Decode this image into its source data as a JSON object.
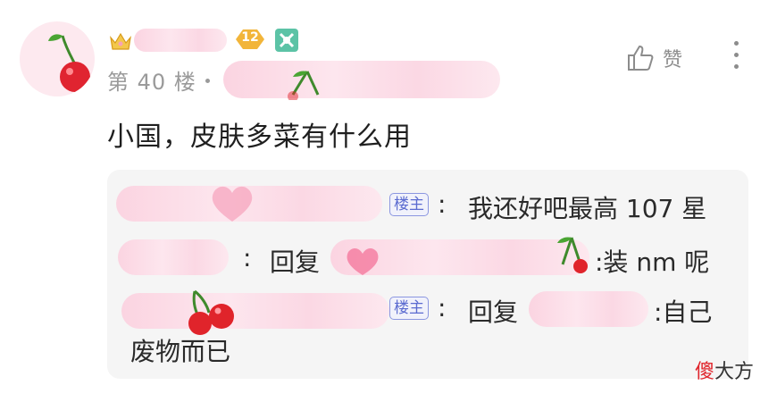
{
  "post": {
    "floor_label": "第 40 楼",
    "level_badge": "12",
    "like_label": "赞",
    "comment_text": "小国，皮肤多菜有什么用"
  },
  "replies": [
    {
      "author_tag": "楼主",
      "separator": ":",
      "text": "我还好吧最高 107 星"
    },
    {
      "separator": ":",
      "prefix": "回复",
      "text": ":装 nm 呢"
    },
    {
      "author_tag": "楼主",
      "separator": ":",
      "prefix": "回复",
      "text": ":自己",
      "text_cont": "废物而已"
    }
  ],
  "watermark": {
    "first": "傻",
    "rest": "大方"
  },
  "colors": {
    "blur_pink": "#fbd4e1",
    "cherry_red": "#e0242b",
    "reply_bg": "#f5f5f5",
    "author_tag_blue": "#5b6bd0",
    "level_badge_gold": "#f2b53a",
    "square_badge_teal": "#5cc3a6"
  },
  "icons": {
    "avatar": "cherry-avatar",
    "crown": "crown-badge-icon",
    "level": "diamond-level-icon",
    "square": "star-square-badge-icon",
    "like": "thumbs-up-icon",
    "more": "vertical-ellipsis-icon"
  }
}
